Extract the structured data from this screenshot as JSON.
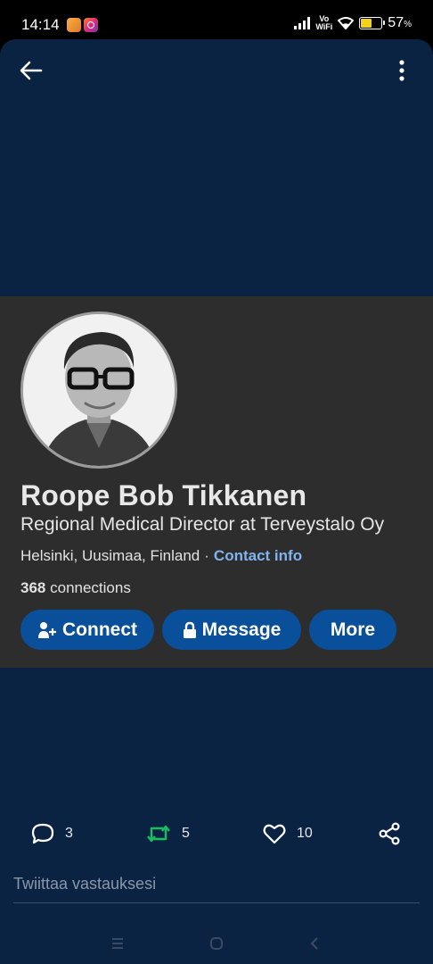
{
  "status_bar": {
    "time": "14:14",
    "network": "Vo WiFi",
    "network_line1": "Vo",
    "network_line2": "WiFi",
    "battery_percent": "57",
    "battery_unit": "%",
    "battery_level": 0.57,
    "battery_color": "#f2d318",
    "notification_icons": [
      "app-notification-icon",
      "instagram-icon"
    ]
  },
  "top_bar": {
    "back_icon": "arrow-left-icon",
    "menu_icon": "more-vertical-icon"
  },
  "profile": {
    "name": "Roope Bob Tikkanen",
    "headline": "Regional Medical Director at Terveystalo Oy",
    "location": "Helsinki, Uusimaa, Finland",
    "separator": "·",
    "contact_info": "Contact info",
    "connections_count": "368",
    "connections_label": "connections",
    "avatar_icon": "profile-photo",
    "buttons": {
      "connect": "Connect",
      "message": "Message",
      "more": "More"
    }
  },
  "tweet_actions": {
    "replies": "3",
    "retweets": "5",
    "likes": "10",
    "retweet_color": "#17bf63"
  },
  "reply": {
    "placeholder": "Twiittaa vastauksesi"
  },
  "colors": {
    "background": "#0b2342",
    "card": "#2d2d2d",
    "button": "#0a4f9a",
    "link": "#7fb4ef"
  }
}
